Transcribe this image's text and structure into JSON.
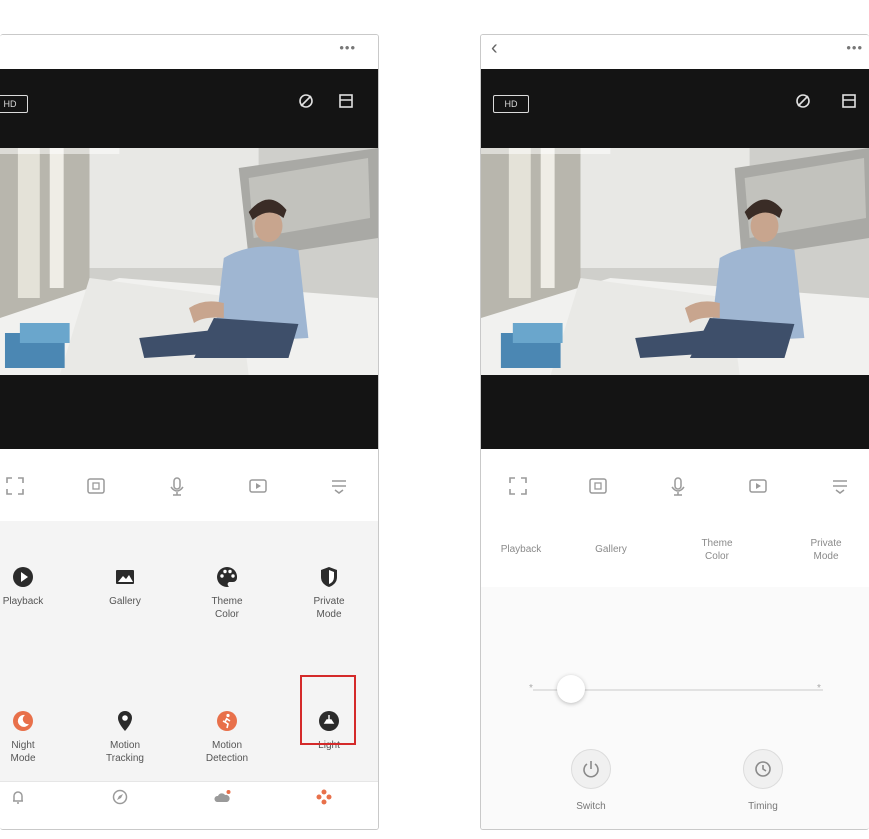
{
  "left_phone": {
    "hd_badge": "HD",
    "features": [
      {
        "label": "Playback",
        "icon": "play-icon",
        "color": "#2b2b2b"
      },
      {
        "label": "Gallery",
        "icon": "gallery-icon",
        "color": "#2b2b2b"
      },
      {
        "label": "Theme\nColor",
        "icon": "palette-icon",
        "color": "#2b2b2b"
      },
      {
        "label": "Private\nMode",
        "icon": "shield-icon",
        "color": "#2b2b2b"
      },
      {
        "label": "Night\nMode",
        "icon": "night-mode-icon",
        "color": "#e8704a"
      },
      {
        "label": "Motion\nTracking",
        "icon": "location-pin-icon",
        "color": "#2b2b2b"
      },
      {
        "label": "Motion\nDetection",
        "icon": "motion-detection-icon",
        "color": "#e8704a"
      },
      {
        "label": "Light",
        "icon": "light-icon",
        "color": "#2b2b2b"
      }
    ],
    "highlighted_feature": "Light",
    "bottom_nav": [
      {
        "icon": "message-icon"
      },
      {
        "icon": "explore-icon"
      },
      {
        "icon": "cloud-icon"
      },
      {
        "icon": "features-icon",
        "active": true
      }
    ]
  },
  "right_phone": {
    "hd_badge": "HD",
    "tabs": [
      "Playback",
      "Gallery",
      "Theme\nColor",
      "Private\nMode"
    ],
    "slider_min": "*",
    "slider_max": "*",
    "switch_label": "Switch",
    "timing_label": "Timing"
  },
  "colors": {
    "accent": "#e8704a",
    "highlight_box": "#d42a2a",
    "video_bar": "#141414"
  }
}
